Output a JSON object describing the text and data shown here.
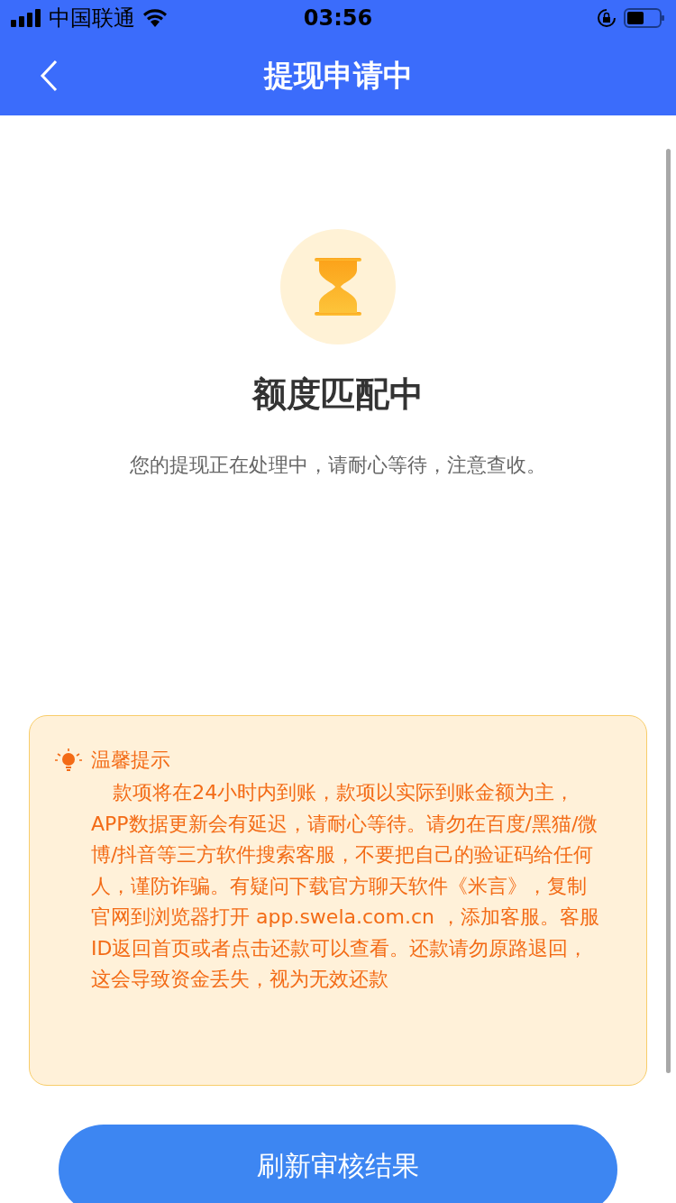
{
  "status_bar": {
    "carrier": "中国联通",
    "time": "03:56"
  },
  "nav": {
    "title": "提现申请中"
  },
  "status": {
    "title": "额度匹配中",
    "message": "您的提现正在处理中，请耐心等待，注意查收。"
  },
  "tips": {
    "title": "温馨提示",
    "body": "款项将在24小时内到账，款项以实际到账金额为主，APP数据更新会有延迟，请耐心等待。请勿在百度/黑猫/微博/抖音等三方软件搜索客服，不要把自己的验证码给任何人，谨防诈骗。有疑问下载官方聊天软件《米言》，复制官网到浏览器打开 app.swela.com.cn ，添加客服。客服ID返回首页或者点击还款可以查看。还款请勿原路退回，这会导致资金丢失，视为无效还款"
  },
  "button": {
    "label": "刷新审核结果"
  }
}
